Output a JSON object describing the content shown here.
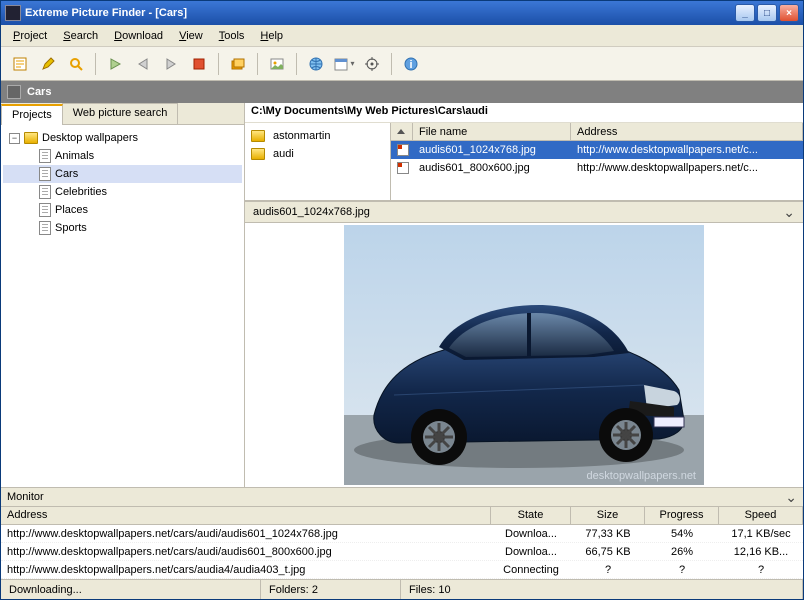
{
  "window": {
    "title": "Extreme Picture Finder - [Cars]"
  },
  "menus": [
    "Project",
    "Search",
    "Download",
    "View",
    "Tools",
    "Help"
  ],
  "catbar": {
    "title": "Cars"
  },
  "tabs": {
    "projects": "Projects",
    "websearch": "Web picture search"
  },
  "tree": {
    "root": "Desktop wallpapers",
    "children": [
      "Animals",
      "Cars",
      "Celebrities",
      "Places",
      "Sports"
    ],
    "selected": "Cars"
  },
  "path": "C:\\My Documents\\My Web Pictures\\Cars\\audi",
  "dirs": [
    "astonmartin",
    "audi"
  ],
  "file_columns": {
    "name": "File name",
    "address": "Address"
  },
  "files": [
    {
      "name": "audis601_1024x768.jpg",
      "address": "http://www.desktopwallpapers.net/c..."
    },
    {
      "name": "audis601_800x600.jpg",
      "address": "http://www.desktopwallpapers.net/c..."
    }
  ],
  "selected_file_index": 0,
  "preview": {
    "filename": "audis601_1024x768.jpg"
  },
  "monitor": {
    "title": "Monitor",
    "columns": {
      "address": "Address",
      "state": "State",
      "size": "Size",
      "progress": "Progress",
      "speed": "Speed"
    },
    "rows": [
      {
        "address": "http://www.desktopwallpapers.net/cars/audi/audis601_1024x768.jpg",
        "state": "Downloa...",
        "size": "77,33 KB",
        "progress": "54%",
        "speed": "17,1 KB/sec"
      },
      {
        "address": "http://www.desktopwallpapers.net/cars/audi/audis601_800x600.jpg",
        "state": "Downloa...",
        "size": "66,75 KB",
        "progress": "26%",
        "speed": "12,16 KB..."
      },
      {
        "address": "http://www.desktopwallpapers.net/cars/audia4/audia403_t.jpg",
        "state": "Connecting",
        "size": "?",
        "progress": "?",
        "speed": "?"
      }
    ]
  },
  "status": {
    "left": "Downloading...",
    "folders_label": "Folders:",
    "folders": "2",
    "files_label": "Files:",
    "files": "10"
  },
  "col_widths": {
    "file_name": 180,
    "mon_addr": 490,
    "mon_state": 80,
    "mon_size": 74,
    "mon_prog": 74,
    "mon_speed": 82
  }
}
